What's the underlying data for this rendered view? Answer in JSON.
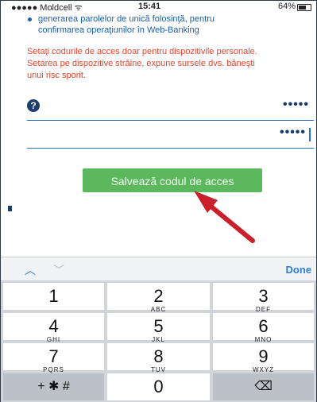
{
  "status_bar": {
    "carrier": "●●●●● Moldcell ᯤ",
    "time": "15:41",
    "battery": "64%"
  },
  "content": {
    "bullet_text_1": "generarea parolelor de unică folosinţă, pentru",
    "bullet_text_2": "confirmarea operaţiunilor în Web-Banking",
    "warning_lines": [
      "Setaţi codurile de acces doar pentru dispozitivile personale.",
      "Setarea pe dispozitive străine, expune sursele dvs. băneşti",
      "unui risc sporit."
    ],
    "help_icon_glyph": "?",
    "code_field_mask": "•••••",
    "confirm_field_mask": "•••••",
    "save_button_label": "Salvează codul de acces"
  },
  "keyboard_bar": {
    "up_glyph": "︿",
    "down_glyph": "﹀",
    "done_label": "Done"
  },
  "keypad": {
    "keys": [
      {
        "num": "1",
        "letters": ""
      },
      {
        "num": "2",
        "letters": "ABC"
      },
      {
        "num": "3",
        "letters": "DEF"
      },
      {
        "num": "4",
        "letters": "GHI"
      },
      {
        "num": "5",
        "letters": "JKL"
      },
      {
        "num": "6",
        "letters": "MNO"
      },
      {
        "num": "7",
        "letters": "PQRS"
      },
      {
        "num": "8",
        "letters": "TUV"
      },
      {
        "num": "9",
        "letters": "WXYZ"
      }
    ],
    "symbols": "+ ✱ #",
    "zero": "0",
    "delete_glyph": "⌫"
  },
  "colors": {
    "link_blue": "#1a5fb4",
    "warning_red": "#e8452d",
    "button_green": "#5cb85c",
    "arrow_red": "#c9202a"
  }
}
